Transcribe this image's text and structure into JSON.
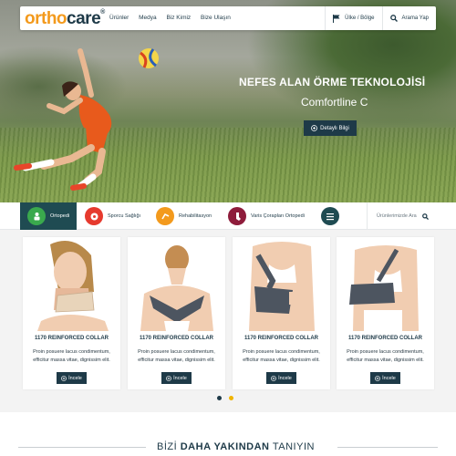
{
  "header": {
    "logo_part1": "ortho",
    "logo_part2": "care",
    "logo_reg": "®",
    "nav": [
      "Ürünler",
      "Medya",
      "Biz Kimiz",
      "Bize Ulaşın"
    ],
    "country_label": "Ülke / Bölge",
    "search_label": "Arama Yap"
  },
  "hero": {
    "title": "NEFES ALAN ÖRME TEKNOLOJİSİ",
    "subtitle": "Comfortline C",
    "button": "Detaylı Bilgi"
  },
  "categories": {
    "items": [
      "Ortopedi",
      "Sporcu Sağlığı",
      "Rehabilitasyon",
      "Varis Çorapları Ortopedi"
    ],
    "active_index": 0,
    "search_placeholder": "Ürünlerimizde Ara"
  },
  "products": [
    {
      "title": "1170 REINFORCED COLLAR",
      "desc": "Proin posuere lacus condimentum, efficitur massa vitae, dignissim elit.",
      "button": "İncele"
    },
    {
      "title": "1170 REINFORCED COLLAR",
      "desc": "Proin posuere lacus condimentum, efficitur massa vitae, dignissim elit.",
      "button": "İncele"
    },
    {
      "title": "1170 REINFORCED COLLAR",
      "desc": "Proin posuere lacus condimentum, efficitur massa vitae, dignissim elit.",
      "button": "İncele"
    },
    {
      "title": "1170 REINFORCED COLLAR",
      "desc": "Proin posuere lacus condimentum, efficitur massa vitae, dignissim elit.",
      "button": "İncele"
    }
  ],
  "carousel": {
    "pages": 2,
    "active": 0
  },
  "section": {
    "pre": "BİZİ",
    "bold": "DAHA YAKINDAN",
    "post": "TANIYIN"
  },
  "colors": {
    "brand_orange": "#f39a1d",
    "navy": "#1e3a48",
    "active_teal": "#1f4b52",
    "green": "#3aa94d",
    "dot_active": "#f0b400"
  }
}
